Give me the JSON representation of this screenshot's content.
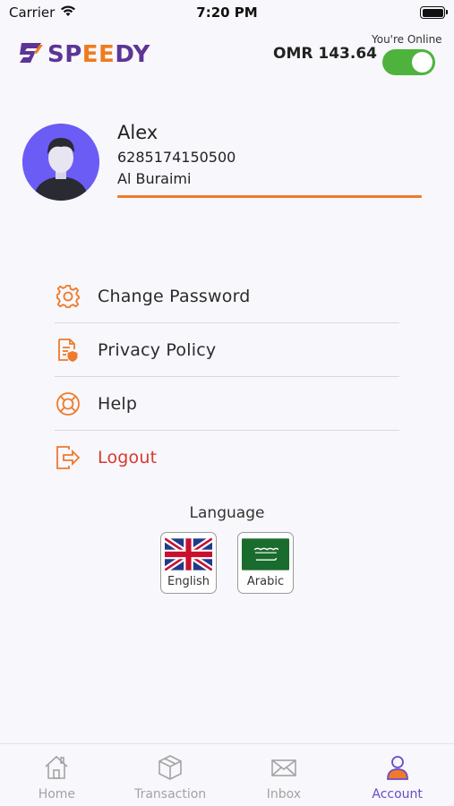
{
  "status_bar": {
    "carrier": "Carrier",
    "time": "7:20 PM"
  },
  "header": {
    "logo": {
      "part1": "SP",
      "part2": "EE",
      "part3": "DY"
    },
    "balance": "OMR 143.64",
    "online_label": "You're Online",
    "online": true
  },
  "profile": {
    "name": "Alex",
    "phone": "6285174150500",
    "city": "Al Buraimi"
  },
  "menu": {
    "items": [
      {
        "label": "Change Password",
        "icon": "gear-icon"
      },
      {
        "label": "Privacy Policy",
        "icon": "document-shield-icon"
      },
      {
        "label": "Help",
        "icon": "lifebuoy-icon"
      },
      {
        "label": "Logout",
        "icon": "logout-icon"
      }
    ]
  },
  "language": {
    "title": "Language",
    "options": [
      {
        "label": "English",
        "flag": "uk-flag"
      },
      {
        "label": "Arabic",
        "flag": "saudi-flag"
      }
    ]
  },
  "tabbar": {
    "tabs": [
      {
        "label": "Home",
        "icon": "home-icon"
      },
      {
        "label": "Transaction",
        "icon": "box-icon"
      },
      {
        "label": "Inbox",
        "icon": "mail-icon"
      },
      {
        "label": "Account",
        "icon": "user-icon",
        "active": true
      }
    ]
  },
  "colors": {
    "brand_purple": "#5c3596",
    "brand_orange": "#f07b1f",
    "toggle_green": "#4db33d",
    "logout_red": "#d63a2f",
    "active_tab": "#6a4cc6"
  }
}
